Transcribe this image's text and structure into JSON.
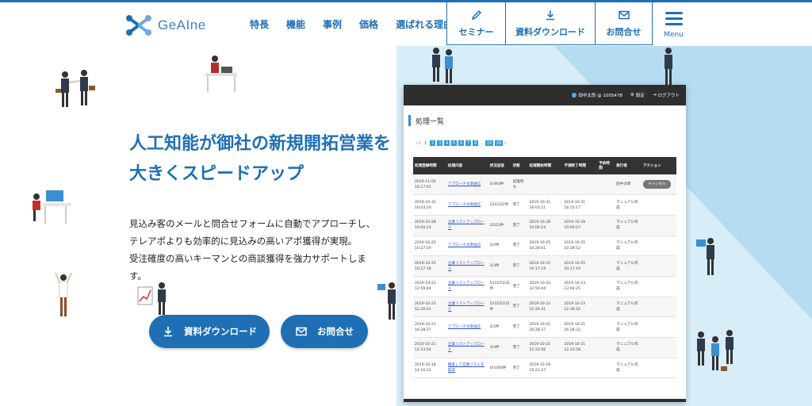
{
  "brand": {
    "logo_text": "GeAIne"
  },
  "nav": [
    "特長",
    "機能",
    "事例",
    "価格",
    "選ばれる理由"
  ],
  "header_buttons": {
    "seminar": "セミナー",
    "download": "資料ダウンロード",
    "contact": "お問合せ",
    "menu": "Menu"
  },
  "hero": {
    "title_line1": "人工知能が御社の新規開拓営業を",
    "title_line2": "大きくスピードアップ",
    "desc_line1": "見込み客のメールと問合せフォームに自動でアプローチし、",
    "desc_line2": "テレアポよりも効率的に見込みの高いアポ獲得が実現。",
    "desc_line3": "受注確度の高いキーマンとの商談獲得を強力サポートしま",
    "desc_line4": "す。",
    "cta_download": "資料ダウンロード",
    "cta_contact": "お問合せ"
  },
  "app": {
    "user": "田中太郎 @ 1005478",
    "settings": "設定",
    "logout": "ログアウト",
    "page_title": "処理一覧",
    "pager": {
      "first": "«1",
      "current": "1",
      "pages": [
        "2",
        "3",
        "4",
        "5",
        "6",
        "7",
        "8"
      ],
      "ellipsis": "...",
      "last_pages": [
        "19",
        "20"
      ],
      "next": "»"
    },
    "columns": [
      "処理登録時間",
      "処理内容",
      "状況送信",
      "状態",
      "処理開始時間",
      "予測終了時間",
      "予約時間",
      "実行者",
      "アクション"
    ],
    "rows": [
      {
        "reg": "2019-11-05 16:17:55",
        "task": "アプローチ文章送信",
        "progress": "0/393件",
        "status": "処理待ち",
        "start": "",
        "end": "",
        "reserve": "",
        "user": "田中太郎",
        "action": "キャンセル"
      },
      {
        "reg": "2019-10-31 16:03:20",
        "task": "アプローチ文章送信",
        "progress": "222/222件",
        "status": "完了",
        "start": "2019-10-31 16:03:21",
        "end": "2019-10-31 16:15:17",
        "reserve": "",
        "user": "マニュアル作成",
        "action": ""
      },
      {
        "reg": "2019-10-28 10:00:23",
        "task": "企業リストアップロード",
        "progress": "22/22件",
        "status": "完了",
        "start": "2019-10-28 10:00:24",
        "end": "2019-10-28 10:00:27",
        "reserve": "",
        "user": "マニュアル作成",
        "action": ""
      },
      {
        "reg": "2019-10-25 10:27:59",
        "task": "アプローチ文章送信",
        "progress": "2/2件",
        "status": "完了",
        "start": "2019-10-25 10:28:01",
        "end": "2019-10-25 10:28:52",
        "reserve": "",
        "user": "マニュアル作成",
        "action": ""
      },
      {
        "reg": "2019-10-25 10:17:18",
        "task": "企業リストアップロード",
        "progress": "3/3件",
        "status": "完了",
        "start": "2019-10-25 10:17:19",
        "end": "2019-10-25 10:17:19",
        "reserve": "",
        "user": "マニュアル作成",
        "action": ""
      },
      {
        "reg": "2019-10-23 12:59:44",
        "task": "企業リストアップロード",
        "progress": "5315/5315件",
        "status": "完了",
        "start": "2019-10-23 12:59:44",
        "end": "2019-10-23 13:04:25",
        "reserve": "",
        "user": "マニュアル作成",
        "action": ""
      },
      {
        "reg": "2019-10-23 12:26:01",
        "task": "企業リストアップロード",
        "progress": "5315/5315件",
        "status": "完了",
        "start": "2019-10-23 12:34:41",
        "end": "2019-10-23 12:39:16",
        "reserve": "",
        "user": "マニュアル作成",
        "action": ""
      },
      {
        "reg": "2019-10-21 16:28:27",
        "task": "アプローチ文章送信",
        "progress": "2/2件",
        "status": "完了",
        "start": "2019-10-21 16:28:27",
        "end": "2019-10-21 16:28:32",
        "reserve": "",
        "user": "マニュアル作成",
        "action": ""
      },
      {
        "reg": "2019-10-21 12:33:54",
        "task": "企業リストアップロード",
        "progress": "3/3件",
        "status": "完了",
        "start": "2019-10-21 12:33:56",
        "end": "2019-10-21 12:33:58",
        "reserve": "",
        "user": "マニュアル作成",
        "action": ""
      },
      {
        "reg": "2019-10-18 14:16:15",
        "task": "精査して営業リストを取得",
        "progress": "0/1000件",
        "status": "完了",
        "start": "2019-10-18 15:21:27",
        "end": "",
        "reserve": "",
        "user": "マニュアル作成",
        "action": ""
      }
    ]
  },
  "colors": {
    "primary": "#1f6fb5",
    "accent": "#2c9cdc",
    "bg_light": "#d7edf8",
    "bg_mid": "#b5dcf1"
  }
}
